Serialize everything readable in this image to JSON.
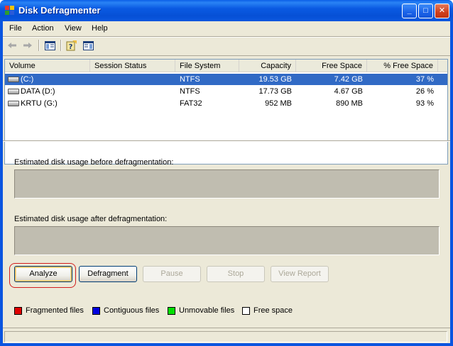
{
  "window": {
    "title": "Disk Defragmenter",
    "controls": {
      "minimize": "_",
      "maximize": "□",
      "close": "✕"
    }
  },
  "menu": [
    "File",
    "Action",
    "View",
    "Help"
  ],
  "toolbar": {
    "icons": [
      "back-arrow-icon",
      "forward-arrow-icon",
      "show-hide-tree-icon",
      "help-icon",
      "properties-icon"
    ]
  },
  "volume_list": {
    "columns": [
      "Volume",
      "Session Status",
      "File System",
      "Capacity",
      "Free Space",
      "% Free Space"
    ],
    "rows": [
      {
        "volume": "(C:)",
        "session_status": "",
        "file_system": "NTFS",
        "capacity": "19.53 GB",
        "free_space": "7.42 GB",
        "pct_free": "37 %",
        "selected": true
      },
      {
        "volume": "DATA (D:)",
        "session_status": "",
        "file_system": "NTFS",
        "capacity": "17.73 GB",
        "free_space": "4.67 GB",
        "pct_free": "26 %",
        "selected": false
      },
      {
        "volume": "KRTU (G:)",
        "session_status": "",
        "file_system": "FAT32",
        "capacity": "952 MB",
        "free_space": "890 MB",
        "pct_free": "93 %",
        "selected": false
      }
    ]
  },
  "usage": {
    "before_label": "Estimated disk usage before defragmentation:",
    "after_label": "Estimated disk usage after defragmentation:"
  },
  "buttons": {
    "analyze": "Analyze",
    "defragment": "Defragment",
    "pause": "Pause",
    "stop": "Stop",
    "view_report": "View Report"
  },
  "legend": [
    {
      "label": "Fragmented files",
      "color": "#e00000"
    },
    {
      "label": "Contiguous files",
      "color": "#0000e0"
    },
    {
      "label": "Unmovable files",
      "color": "#00e000"
    },
    {
      "label": "Free space",
      "color": "#ffffff"
    }
  ]
}
